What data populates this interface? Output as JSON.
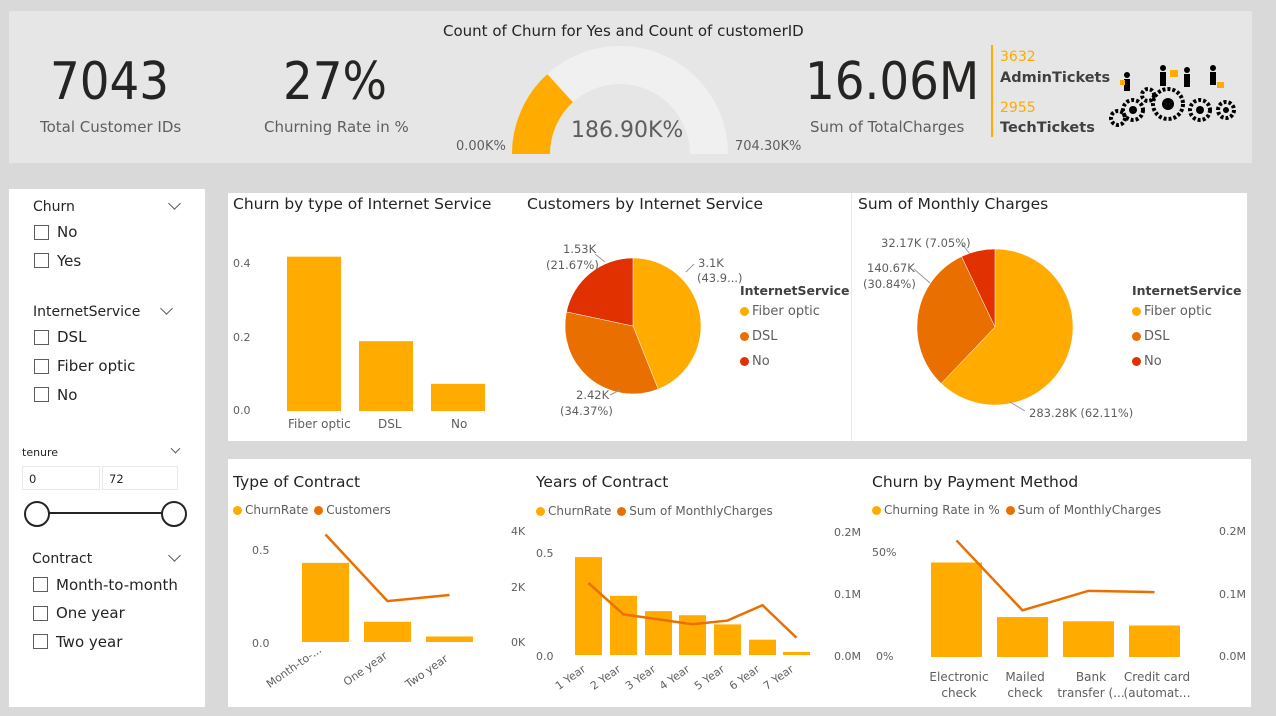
{
  "colors": {
    "gold": "#FFAB00",
    "orange": "#E97000",
    "red": "#E23100",
    "gauge_bg": "#f0f0f0"
  },
  "kpis": {
    "total_customers": {
      "value": "7043",
      "label": "Total Customer IDs"
    },
    "churn_rate": {
      "value": "27%",
      "label": "Churning Rate in %"
    },
    "gauge": {
      "title": "Count of Churn for Yes and Count of customerID",
      "value_text": "186.90K%",
      "min": "0.00K%",
      "max": "704.30K%",
      "fill_fraction": 0.265
    },
    "total_charges": {
      "value": "16.06M",
      "label": "Sum of TotalCharges"
    },
    "tickets": {
      "admin_count": "3632",
      "admin_label": "AdminTickets",
      "tech_count": "2955",
      "tech_label": "TechTickets",
      "icon": "gears-workers-icon"
    }
  },
  "slicers": {
    "churn": {
      "title": "Churn",
      "options": [
        "No",
        "Yes"
      ]
    },
    "internet_service": {
      "title": "InternetService",
      "options": [
        "DSL",
        "Fiber optic",
        "No"
      ]
    },
    "tenure": {
      "title": "tenure",
      "min": "0",
      "max": "72"
    },
    "contract": {
      "title": "Contract",
      "options": [
        "Month-to-month",
        "One year",
        "Two year"
      ]
    }
  },
  "charts": {
    "churn_internet": {
      "title": "Churn by type of Internet Service"
    },
    "customers_internet": {
      "title": "Customers by Internet Service",
      "legend_title": "InternetService",
      "legend": [
        "Fiber optic",
        "DSL",
        "No"
      ],
      "labels": {
        "fiber": [
          "3.1K",
          "(43.9...)"
        ],
        "dsl": [
          "2.42K",
          "(34.37%)"
        ],
        "no": [
          "1.53K",
          "(21.67%)"
        ]
      }
    },
    "monthly_charges": {
      "title": "Sum of Monthly Charges",
      "legend_title": "InternetService",
      "legend": [
        "Fiber optic",
        "DSL",
        "No"
      ],
      "labels": {
        "fiber": "283.28K (62.11%)",
        "dsl": [
          "140.67K",
          "(30.84%)"
        ],
        "no": "32.17K (7.05%)"
      }
    },
    "contract_type": {
      "title": "Type of Contract",
      "legend": [
        "ChurnRate",
        "Customers"
      ]
    },
    "contract_years": {
      "title": "Years of Contract",
      "legend": [
        "ChurnRate",
        "Sum of MonthlyCharges"
      ]
    },
    "payment": {
      "title": "Churn by Payment Method",
      "legend": [
        "Churning Rate in %",
        "Sum of MonthlyCharges"
      ]
    }
  },
  "chart_data": [
    {
      "type": "bar",
      "title": "Churn by type of Internet Service",
      "categories": [
        "Fiber optic",
        "DSL",
        "No"
      ],
      "values": [
        0.42,
        0.19,
        0.074
      ],
      "yticks": [
        "0.4",
        "0.2",
        "0.0"
      ],
      "ylim": [
        0,
        0.45
      ]
    },
    {
      "type": "pie",
      "title": "Customers by Internet Service",
      "categories": [
        "Fiber optic",
        "DSL",
        "No"
      ],
      "values": [
        3096,
        2421,
        1526
      ]
    },
    {
      "type": "pie",
      "title": "Sum of Monthly Charges",
      "categories": [
        "Fiber optic",
        "DSL",
        "No"
      ],
      "values": [
        283.28,
        140.67,
        32.17
      ]
    },
    {
      "type": "bar",
      "title": "Type of Contract",
      "categories": [
        "Month-to-...",
        "One year",
        "Two year"
      ],
      "series": [
        {
          "name": "ChurnRate",
          "kind": "bar",
          "values": [
            0.43,
            0.11,
            0.03
          ]
        },
        {
          "name": "Customers",
          "kind": "line",
          "values": [
            3875,
            1473,
            1695
          ]
        }
      ],
      "yticks_left": [
        "0.5",
        "0.0"
      ],
      "yticks_right": [
        "4K",
        "2K",
        "0K"
      ],
      "ylim_left": [
        0,
        0.6
      ],
      "ylim_right": [
        0,
        4000
      ]
    },
    {
      "type": "bar",
      "title": "Years of Contract",
      "categories": [
        "1 Year",
        "2 Year",
        "3 Year",
        "4 Year",
        "5 Year",
        "6 Year",
        "7 Year"
      ],
      "series": [
        {
          "name": "ChurnRate",
          "kind": "bar",
          "values": [
            0.48,
            0.29,
            0.215,
            0.195,
            0.15,
            0.075,
            0.015
          ]
        },
        {
          "name": "Sum of MonthlyCharges",
          "kind": "line",
          "values": [
            0.117,
            0.066,
            0.058,
            0.05,
            0.056,
            0.081,
            0.028
          ]
        }
      ],
      "yticks_left": [
        "0.5",
        "0.0"
      ],
      "yticks_right": [
        "0.2M",
        "0.1M",
        "0.0M"
      ],
      "ylim_left": [
        0,
        0.55
      ],
      "ylim_right": [
        0,
        0.2
      ]
    },
    {
      "type": "bar",
      "title": "Churn by Payment Method",
      "categories": [
        "Electronic check",
        "Mailed check",
        "Bank transfer (...",
        "Credit card (automat..."
      ],
      "series": [
        {
          "name": "Churning Rate in %",
          "kind": "bar",
          "values": [
            0.45,
            0.19,
            0.17,
            0.15
          ]
        },
        {
          "name": "Sum of MonthlyCharges",
          "kind": "line",
          "values": [
            0.185,
            0.074,
            0.105,
            0.103
          ]
        }
      ],
      "yticks_left": [
        "50%",
        "0%"
      ],
      "yticks_right": [
        "0.2M",
        "0.1M",
        "0.0M"
      ],
      "ylim_left": [
        0,
        0.55
      ],
      "ylim_right": [
        0,
        0.2
      ]
    }
  ]
}
